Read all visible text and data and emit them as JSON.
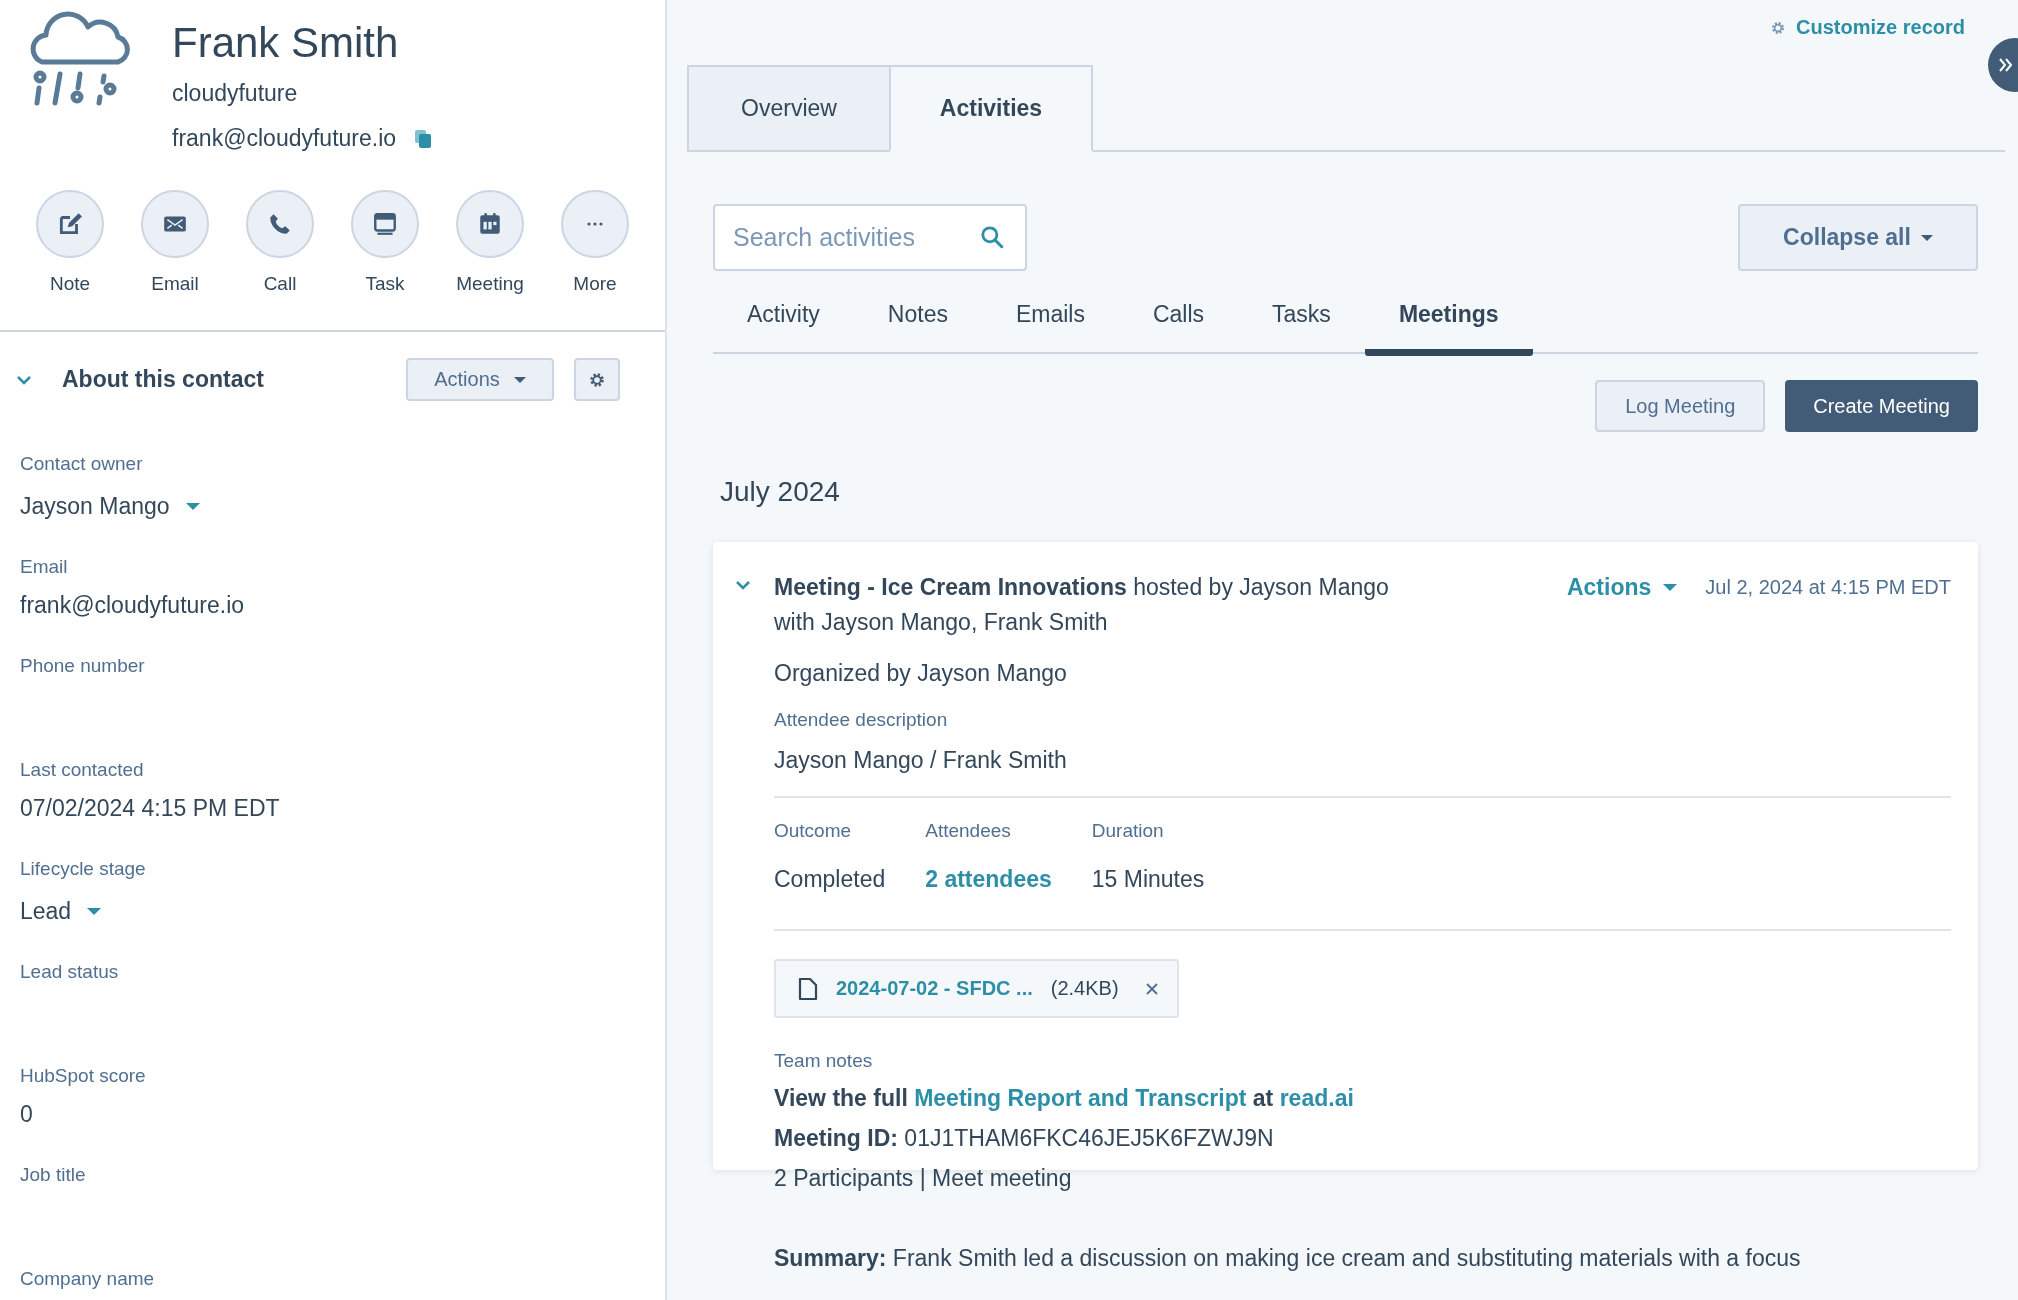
{
  "contact": {
    "name": "Frank Smith",
    "company": "cloudyfuture",
    "email": "frank@cloudyfuture.io"
  },
  "quick_actions": [
    {
      "label": "Note",
      "kind": "note"
    },
    {
      "label": "Email",
      "kind": "email"
    },
    {
      "label": "Call",
      "kind": "call"
    },
    {
      "label": "Task",
      "kind": "task"
    },
    {
      "label": "Meeting",
      "kind": "meeting"
    },
    {
      "label": "More",
      "kind": "more"
    }
  ],
  "about": {
    "title": "About this contact",
    "expanded": true,
    "actions_button": "Actions"
  },
  "fields": [
    {
      "label": "Contact owner",
      "value": "Jayson Mango",
      "kind": "dropdown"
    },
    {
      "label": "Email",
      "value": "frank@cloudyfuture.io",
      "kind": "text"
    },
    {
      "label": "Phone number"
    },
    {
      "label": "Last contacted",
      "value": "07/02/2024 4:15 PM EDT",
      "kind": "text"
    },
    {
      "label": "Lifecycle stage",
      "value": "Lead",
      "kind": "dropdown"
    },
    {
      "label": "Lead status"
    },
    {
      "label": "HubSpot score",
      "value": "0",
      "kind": "text"
    },
    {
      "label": "Job title"
    },
    {
      "label": "Company name"
    }
  ],
  "record": {
    "customize_link": "Customize record",
    "tabs": [
      {
        "label": "Overview",
        "selected": false
      },
      {
        "label": "Activities",
        "selected": true
      }
    ],
    "search": {
      "placeholder": "Search activities"
    },
    "collapse_button": "Collapse all",
    "filter_tabs": [
      {
        "label": "Activity",
        "selected": false
      },
      {
        "label": "Notes",
        "selected": false
      },
      {
        "label": "Emails",
        "selected": false
      },
      {
        "label": "Calls",
        "selected": false
      },
      {
        "label": "Tasks",
        "selected": false
      },
      {
        "label": "Meetings",
        "selected": true
      }
    ],
    "buttons": [
      {
        "label": "Log Meeting",
        "kind": "secondary"
      },
      {
        "label": "Create Meeting",
        "kind": "primary"
      }
    ],
    "month": "July 2024",
    "meeting": {
      "expanded": true,
      "title": "**Meeting - Ice Cream Innovations** hosted by Jayson Mango",
      "with": "with Jayson Mango, Frank Smith",
      "actions": "Actions",
      "date": "Jul 2, 2024 at 4:15 PM EDT",
      "organizer": "Organized by Jayson Mango",
      "attendee_label": "Attendee description",
      "attendee_value": "Jayson Mango / Frank Smith",
      "stats": [
        {
          "label": "Outcome",
          "value": "Completed",
          "kind": "text"
        },
        {
          "label": "Attendees",
          "value": "2 attendees",
          "kind": "link"
        },
        {
          "label": "Duration",
          "value": "15 Minutes",
          "kind": "text"
        }
      ],
      "attachment": {
        "name": "2024-07-02 - SFDC ...",
        "size": "(2.4KB)"
      },
      "notes_label": "Team notes",
      "notes": [
        [
          {
            "text": "View the full ",
            "kind": "bold"
          },
          {
            "text": "Meeting Report and Transcript",
            "kind": "link"
          },
          {
            "text": " at ",
            "kind": "bold"
          },
          {
            "text": "read.ai",
            "kind": "link"
          }
        ],
        [
          {
            "text": "Meeting ID:",
            "kind": "bold"
          },
          {
            "text": " 01J1THAM6FKC46JEJ5K6FZWJ9N",
            "kind": "plain"
          }
        ],
        [
          {
            "text": "2 Participants | Meet meeting",
            "kind": "plain"
          }
        ],
        [
          {
            "text": "Summary:",
            "kind": "bold"
          },
          {
            "text": " Frank Smith led a discussion on making ice cream and substituting materials with a focus",
            "kind": "plain"
          }
        ]
      ]
    }
  }
}
